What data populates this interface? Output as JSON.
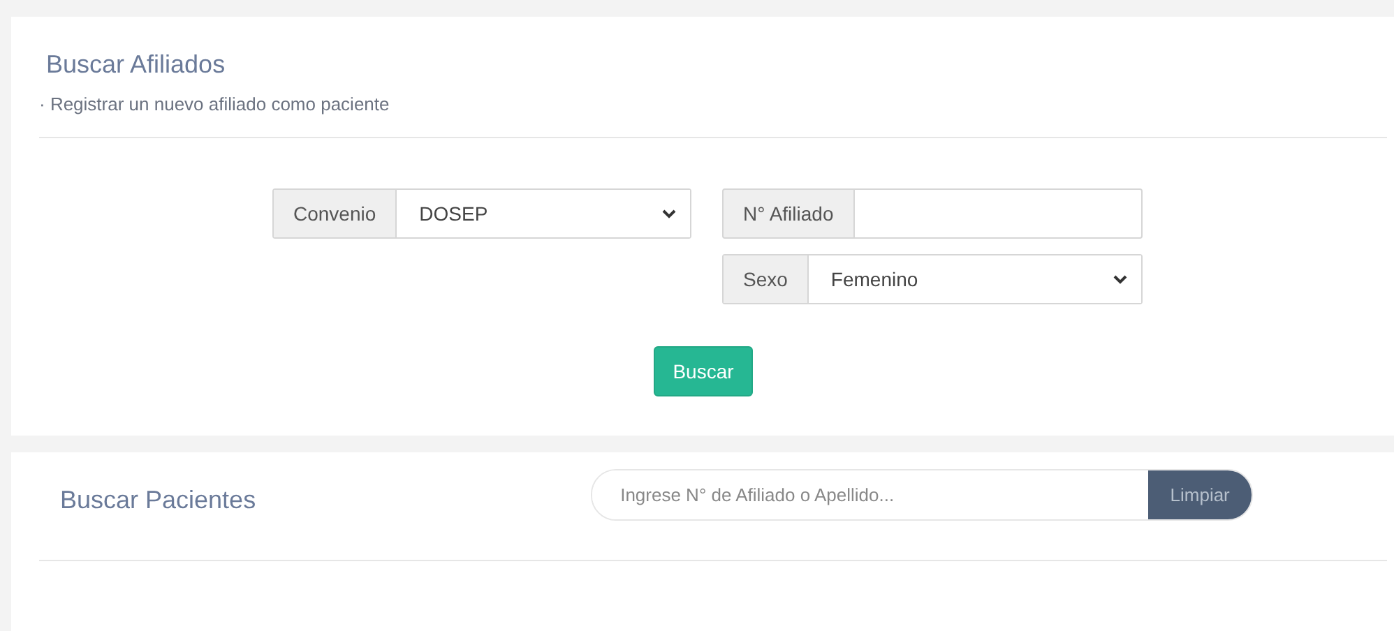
{
  "affiliates": {
    "title": "Buscar Afiliados",
    "subtitle": "· Registrar un nuevo afiliado como paciente",
    "convenio": {
      "label": "Convenio",
      "value": "DOSEP"
    },
    "affiliate_number": {
      "label": "N° Afiliado"
    },
    "sexo": {
      "label": "Sexo",
      "value": "Femenino"
    },
    "button": "Buscar"
  },
  "patients": {
    "title": "Buscar Pacientes",
    "search": {
      "placeholder": "Ingrese N° de Afiliado o Apellido..."
    },
    "button": "Limpiar"
  }
}
